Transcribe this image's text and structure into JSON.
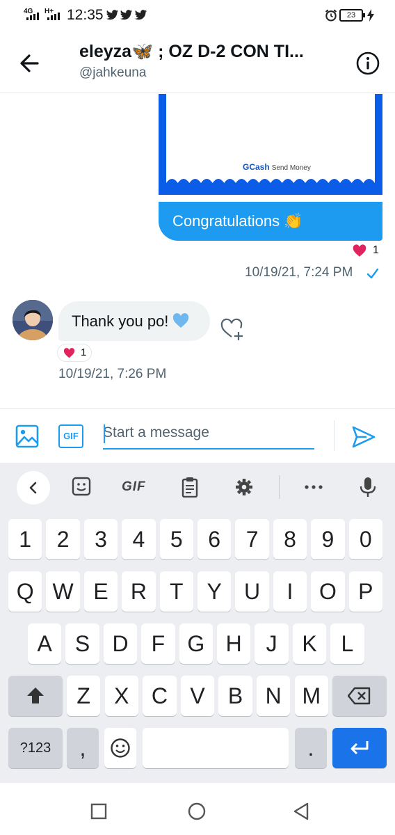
{
  "status_bar": {
    "network_1": "4G",
    "network_2": "H+",
    "time": "12:35",
    "battery": "23",
    "icons": [
      "signal-icon",
      "twitter-icon",
      "twitter-icon",
      "twitter-icon",
      "alarm-icon",
      "battery-icon",
      "charging-icon"
    ]
  },
  "header": {
    "title": "eleyza🦋 ; OZ D-2 CON TI...",
    "handle": "@jahkeuna",
    "back_icon": "back-arrow-icon",
    "info_icon": "info-icon"
  },
  "messages": [
    {
      "direction": "sent",
      "attachment_brand": "GCash",
      "attachment_caption": "Send Money",
      "text": "Congratulations 👏",
      "reaction_count": "1",
      "timestamp": "10/19/21, 7:24 PM",
      "status_icon": "check-icon"
    },
    {
      "direction": "received",
      "text": "Thank you po!",
      "reaction_count": "1",
      "timestamp": "10/19/21, 7:26 PM"
    }
  ],
  "composer": {
    "placeholder": "Start a message",
    "gif_label": "GIF"
  },
  "keyboard": {
    "toolbar_gif": "GIF",
    "rows": [
      [
        "1",
        "2",
        "3",
        "4",
        "5",
        "6",
        "7",
        "8",
        "9",
        "0"
      ],
      [
        "Q",
        "W",
        "E",
        "R",
        "T",
        "Y",
        "U",
        "I",
        "O",
        "P"
      ],
      [
        "A",
        "S",
        "D",
        "F",
        "G",
        "H",
        "J",
        "K",
        "L"
      ],
      [
        "Z",
        "X",
        "C",
        "V",
        "B",
        "N",
        "M"
      ]
    ],
    "symbols_key": "?123",
    "comma_key": ",",
    "period_key": "."
  },
  "colors": {
    "accent": "#1d9bf0",
    "gcash_blue": "#0b5ce6",
    "heart_red": "#e0245e",
    "enter_key": "#1a73e8"
  }
}
